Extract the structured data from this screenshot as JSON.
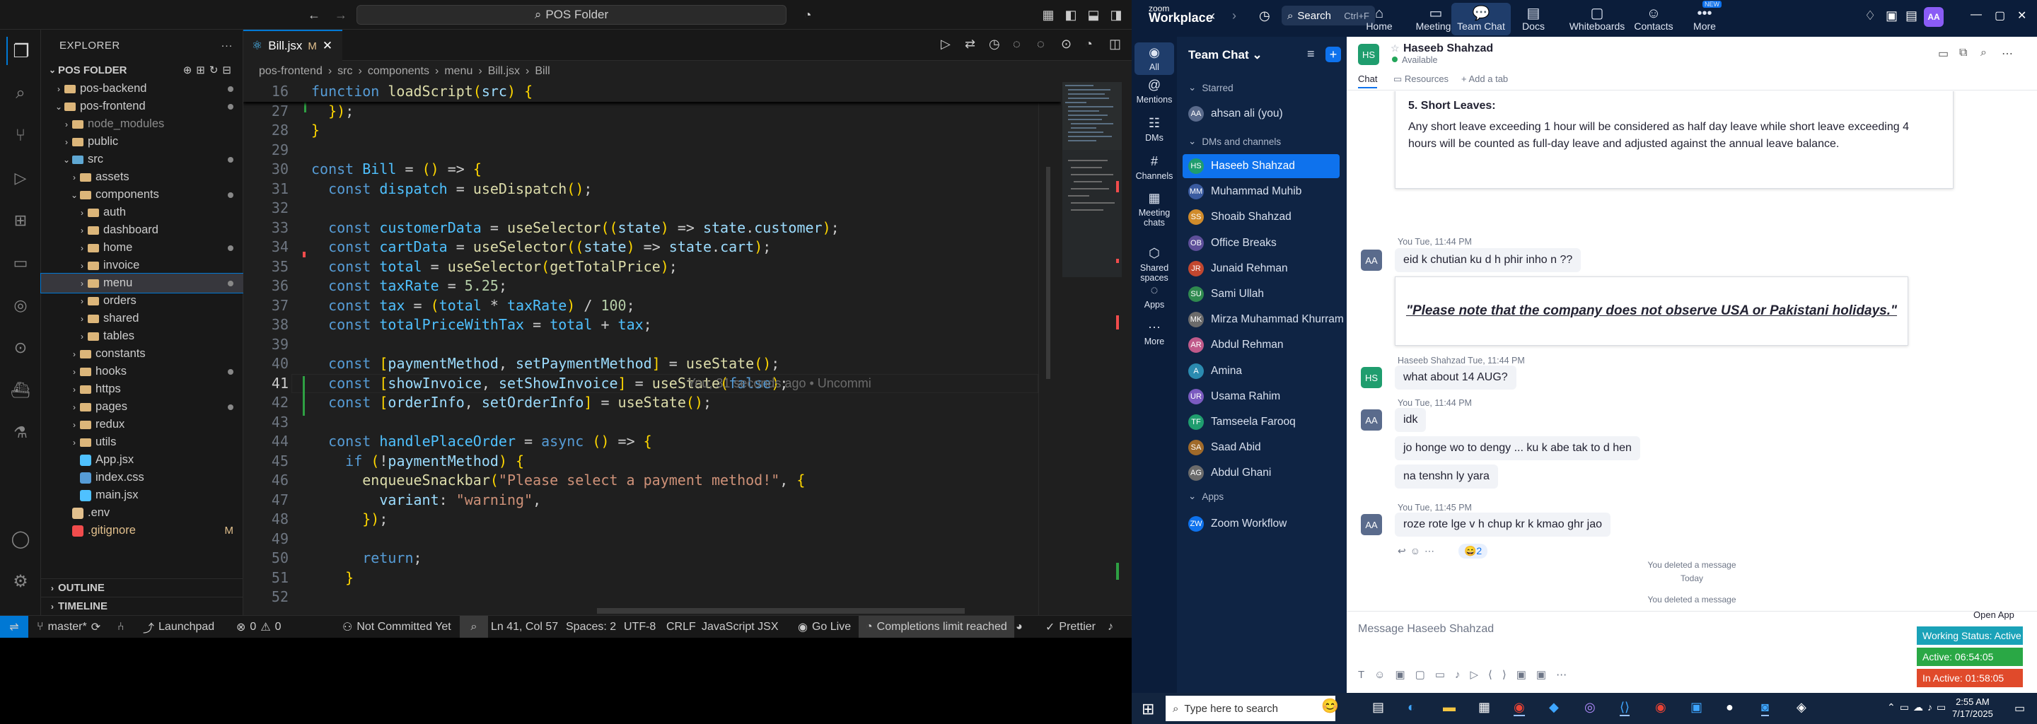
{
  "vscode": {
    "search": "POS Folder",
    "explorer": {
      "title": "EXPLORER",
      "root": "POS FOLDER",
      "tree": [
        {
          "label": "pos-backend",
          "depth": 1,
          "open": false,
          "kind": "folder",
          "dot": true
        },
        {
          "label": "pos-frontend",
          "depth": 1,
          "open": true,
          "kind": "folder",
          "dot": true
        },
        {
          "label": "node_modules",
          "depth": 2,
          "open": false,
          "kind": "folder",
          "muted": true
        },
        {
          "label": "public",
          "depth": 2,
          "open": false,
          "kind": "folder"
        },
        {
          "label": "src",
          "depth": 2,
          "open": true,
          "kind": "src",
          "dot": true
        },
        {
          "label": "assets",
          "depth": 3,
          "open": false,
          "kind": "folder"
        },
        {
          "label": "components",
          "depth": 3,
          "open": true,
          "kind": "folder",
          "dot": true
        },
        {
          "label": "auth",
          "depth": 4,
          "open": false,
          "kind": "folder"
        },
        {
          "label": "dashboard",
          "depth": 4,
          "open": false,
          "kind": "folder"
        },
        {
          "label": "home",
          "depth": 4,
          "open": false,
          "kind": "folder",
          "dot": true
        },
        {
          "label": "invoice",
          "depth": 4,
          "open": false,
          "kind": "folder"
        },
        {
          "label": "menu",
          "depth": 4,
          "open": false,
          "kind": "folder",
          "dot": true,
          "selected": true
        },
        {
          "label": "orders",
          "depth": 4,
          "open": false,
          "kind": "folder"
        },
        {
          "label": "shared",
          "depth": 4,
          "open": false,
          "kind": "folder"
        },
        {
          "label": "tables",
          "depth": 4,
          "open": false,
          "kind": "folder"
        },
        {
          "label": "constants",
          "depth": 3,
          "open": false,
          "kind": "folder"
        },
        {
          "label": "hooks",
          "depth": 3,
          "open": false,
          "kind": "folder",
          "dot": true
        },
        {
          "label": "https",
          "depth": 3,
          "open": false,
          "kind": "folder"
        },
        {
          "label": "pages",
          "depth": 3,
          "open": false,
          "kind": "folder",
          "dot": true
        },
        {
          "label": "redux",
          "depth": 3,
          "open": false,
          "kind": "folder"
        },
        {
          "label": "utils",
          "depth": 3,
          "open": false,
          "kind": "folder"
        },
        {
          "label": "App.jsx",
          "depth": 3,
          "kind": "file",
          "color": "#4fc1ff"
        },
        {
          "label": "index.css",
          "depth": 3,
          "kind": "file",
          "color": "#569cd6"
        },
        {
          "label": "main.jsx",
          "depth": 3,
          "kind": "file",
          "color": "#4fc1ff"
        },
        {
          "label": ".env",
          "depth": 2,
          "kind": "file",
          "color": "#e2c08d"
        },
        {
          "label": ".gitignore",
          "depth": 2,
          "kind": "file",
          "color": "#f14c4c",
          "mod": "M"
        }
      ],
      "outline": "OUTLINE",
      "timeline": "TIMELINE"
    },
    "tab": {
      "name": "Bill.jsx",
      "badge": "M"
    },
    "breadcrumb": [
      "pos-frontend",
      "src",
      "components",
      "menu",
      "Bill.jsx",
      "Bill"
    ],
    "sticky": {
      "num": "16",
      "text": "function loadScript(src) {"
    },
    "lines": [
      {
        "n": "27",
        "t": "  });"
      },
      {
        "n": "28",
        "t": "}"
      },
      {
        "n": "29",
        "t": ""
      },
      {
        "n": "30",
        "t": "const Bill = () => {"
      },
      {
        "n": "31",
        "t": "  const dispatch = useDispatch();"
      },
      {
        "n": "32",
        "t": ""
      },
      {
        "n": "33",
        "t": "  const customerData = useSelector((state) => state.customer);"
      },
      {
        "n": "34",
        "t": "  const cartData = useSelector((state) => state.cart);"
      },
      {
        "n": "35",
        "t": "  const total = useSelector(getTotalPrice);"
      },
      {
        "n": "36",
        "t": "  const taxRate = 5.25;"
      },
      {
        "n": "37",
        "t": "  const tax = (total * taxRate) / 100;"
      },
      {
        "n": "38",
        "t": "  const totalPriceWithTax = total + tax;"
      },
      {
        "n": "39",
        "t": ""
      },
      {
        "n": "40",
        "t": "  const [paymentMethod, setPaymentMethod] = useState();"
      },
      {
        "n": "41",
        "t": "  const [showInvoice, setShowInvoice] = useState(false);"
      },
      {
        "n": "42",
        "t": "  const [orderInfo, setOrderInfo] = useState();"
      },
      {
        "n": "43",
        "t": ""
      },
      {
        "n": "44",
        "t": "  const handlePlaceOrder = async () => {"
      },
      {
        "n": "45",
        "t": "    if (!paymentMethod) {"
      },
      {
        "n": "46",
        "t": "      enqueueSnackbar(\"Please select a payment method!\", {"
      },
      {
        "n": "47",
        "t": "        variant: \"warning\","
      },
      {
        "n": "48",
        "t": "      });"
      },
      {
        "n": "49",
        "t": ""
      },
      {
        "n": "50",
        "t": "      return;"
      },
      {
        "n": "51",
        "t": "    }"
      },
      {
        "n": "52",
        "t": ""
      }
    ],
    "blame": "You, 31 seconds ago • Uncommi",
    "status": {
      "branch": "master*",
      "errors": "0",
      "warnings": "0",
      "launchpad": "Launchpad",
      "commit": "Not Committed Yet",
      "position": "Ln 41, Col 57",
      "spaces": "Spaces: 2",
      "encoding": "UTF-8",
      "eol": "CRLF",
      "language": "JavaScript JSX",
      "golive": "Go Live",
      "completions": "Completions limit reached",
      "prettier": "Prettier"
    }
  },
  "zoom": {
    "brand_top": "zoom",
    "brand": "Workplace",
    "search": "Search",
    "shortcut": "Ctrl+F",
    "tabs": [
      {
        "label": "Home",
        "icon": "⌂"
      },
      {
        "label": "Meetings",
        "icon": "▭"
      },
      {
        "label": "Team Chat",
        "icon": "💬",
        "active": true
      },
      {
        "label": "Docs",
        "icon": "▤"
      },
      {
        "label": "Whiteboards",
        "icon": "▢"
      },
      {
        "label": "Contacts",
        "icon": "☺"
      },
      {
        "label": "More",
        "icon": "•••",
        "badge": "NEW"
      }
    ],
    "user_initials": "AA",
    "rail": [
      {
        "label": "All",
        "icon": "◉",
        "active": true
      },
      {
        "label": "Mentions",
        "icon": "@"
      },
      {
        "label": "DMs",
        "icon": "☷"
      },
      {
        "label": "Channels",
        "icon": "#"
      },
      {
        "label": "Meeting chats",
        "icon": "▦"
      },
      {
        "label": "Shared spaces",
        "icon": "⬡"
      },
      {
        "label": "Apps",
        "icon": "◌"
      },
      {
        "label": "More",
        "icon": "···"
      }
    ],
    "list_title": "Team Chat",
    "starred": "Starred",
    "starred_items": [
      {
        "name": "ahsan ali (you)",
        "initials": "AA",
        "color": "#5a6b8c"
      }
    ],
    "dms_header": "DMs and channels",
    "dms": [
      {
        "name": "Haseeb Shahzad",
        "initials": "HS",
        "color": "#1f9d6e",
        "selected": true
      },
      {
        "name": "Muhammad Muhib",
        "initials": "MM",
        "color": "#3a5ba0"
      },
      {
        "name": "Shoaib Shahzad",
        "initials": "SS",
        "color": "#d08b2b"
      },
      {
        "name": "Office Breaks",
        "initials": "OB",
        "color": "#5e4f9a"
      },
      {
        "name": "Junaid Rehman",
        "initials": "JR",
        "color": "#c2472f"
      },
      {
        "name": "Sami Ullah",
        "initials": "SU",
        "color": "#2f8a4f"
      },
      {
        "name": "Mirza Muhammad Khurram",
        "initials": "MK",
        "color": "#6b6b6b"
      },
      {
        "name": "Abdul Rehman",
        "initials": "AR",
        "color": "#c05a8a"
      },
      {
        "name": "Amina",
        "initials": "A",
        "color": "#2b8bb0"
      },
      {
        "name": "Usama Rahim",
        "initials": "UR",
        "color": "#7b5bc0"
      },
      {
        "name": "Tamseela Farooq",
        "initials": "TF",
        "color": "#1f9d6e"
      },
      {
        "name": "Saad Abid",
        "initials": "SA",
        "color": "#a06a2a"
      },
      {
        "name": "Abdul Ghani",
        "initials": "AG",
        "color": "#6b6b6b"
      }
    ],
    "apps_header": "Apps",
    "apps": [
      {
        "name": "Zoom Workflow",
        "initials": "ZW",
        "color": "#0e72ed"
      }
    ],
    "chat": {
      "name": "Haseeb Shahzad",
      "initials": "HS",
      "status": "Available",
      "tab_chat": "Chat",
      "tab_resources": "Resources",
      "tab_add": "Add a tab",
      "card1_title": "5. Short Leaves:",
      "card1_body1": "Any short leave exceeding 1 hour will be considered as half day leave while short leave exceeding 4",
      "card1_body2": "hours will be counted as full-day leave and adjusted against the annual leave balance.",
      "m1_meta": "You Tue, 11:44 PM",
      "m1": "eid k chutian ku d h phir inho n ??",
      "card2": "\"Please note that the company does not observe USA or Pakistani holidays.\"",
      "m2_meta": "Haseeb Shahzad  Tue, 11:44 PM",
      "m2": "what about 14 AUG?",
      "m3_meta": "You Tue, 11:44 PM",
      "m3a": "idk",
      "m3b": "jo honge wo to dengy ... ku k abe tak to d hen",
      "m3c": "na tenshn ly yara",
      "m4_meta": "You Tue, 11:45 PM",
      "m4": "roze rote lge v h chup kr k kmao ghr jao",
      "reaction": "😄2",
      "today": "Today",
      "deleted1": "You deleted a message",
      "deleted2": "You deleted a message",
      "composer": "Message Haseeb Shahzad"
    },
    "open_app": "Open App",
    "working": "Working Status: Active",
    "active": "Active: 06:54:05",
    "inactive": "In Active: 01:58:05",
    "taskbar": {
      "search": "Type here to search",
      "time": "2:55 AM",
      "date": "7/17/2025"
    }
  }
}
